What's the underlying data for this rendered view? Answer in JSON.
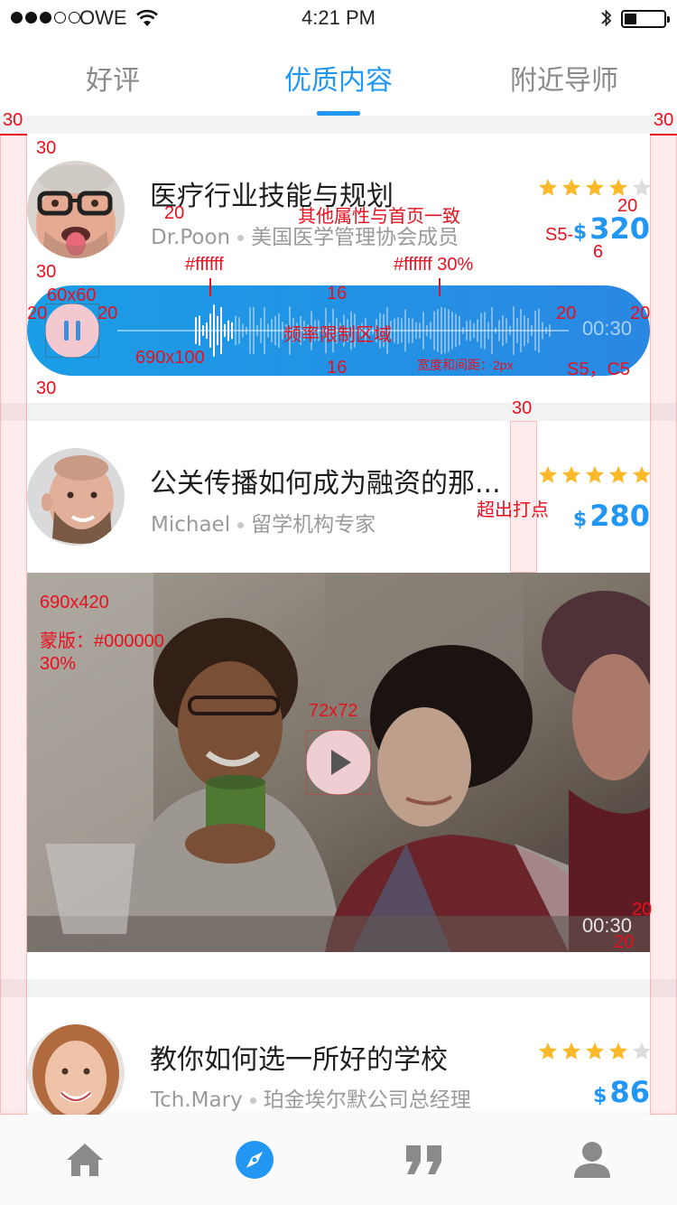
{
  "status_bar": {
    "carrier": "OWE",
    "time": "4:21 PM",
    "battery_level": 0.3
  },
  "tabs": [
    {
      "label": "好评",
      "active": false
    },
    {
      "label": "优质内容",
      "active": true
    },
    {
      "label": "附近导师",
      "active": false
    }
  ],
  "colors": {
    "accent": "#2196f3",
    "star": "#fbb829",
    "star_empty": "#dddddd",
    "annotation": "#e8101e"
  },
  "feed": [
    {
      "title": "医疗行业技能与规划",
      "author": "Dr.Poon",
      "role": "美国医学管理协会成员",
      "rating": 4,
      "currency": "$",
      "price": "320",
      "media": {
        "type": "audio",
        "duration": "00:30",
        "playing": true
      }
    },
    {
      "title": "公关传播如何成为融资的那...",
      "author": "Michael",
      "role": "留学机构专家",
      "rating": 5,
      "currency": "$",
      "price": "280",
      "media": {
        "type": "video",
        "duration": "00:30"
      }
    },
    {
      "title": "教你如何选一所好的学校",
      "author": "Tch.Mary",
      "role": "珀金埃尔默公司总经理",
      "rating": 4,
      "currency": "$",
      "price": "86"
    }
  ],
  "bottom_nav": [
    {
      "icon": "home-icon",
      "active": false
    },
    {
      "icon": "compass-icon",
      "active": true
    },
    {
      "icon": "quote-icon",
      "active": false
    },
    {
      "icon": "user-icon",
      "active": false
    }
  ],
  "annotations": {
    "margin_left": "30",
    "margin_right": "30",
    "top_pad": "30",
    "gap_20": "20",
    "other_props": "其他属性与首页一致",
    "price_spec": "S5-",
    "price_gap": "6",
    "right_20": "20",
    "wave_color": "#ffffff",
    "wave_color_dim": "#ffffff 30%",
    "btn_size": "60x60",
    "pad_16_top": "16",
    "pad_16_bottom": "16",
    "pad_left_20": "20",
    "pad_btn_20": "20",
    "pad_time_20": "20",
    "pad_right_20": "20",
    "freq_area": "频率限制区域",
    "bar_size": "690x100",
    "bar_width_gap": "宽度和间距：2px",
    "time_spec": "S5，C5",
    "bottom_pad": "30",
    "ellipsis_width": "30",
    "ellipsis_note": "超出打点",
    "video_size": "690x420",
    "mask_note": "蒙版：#000000",
    "mask_opacity": "30%",
    "play_size": "72x72",
    "video_right_20": "20",
    "video_bottom_20": "20"
  }
}
